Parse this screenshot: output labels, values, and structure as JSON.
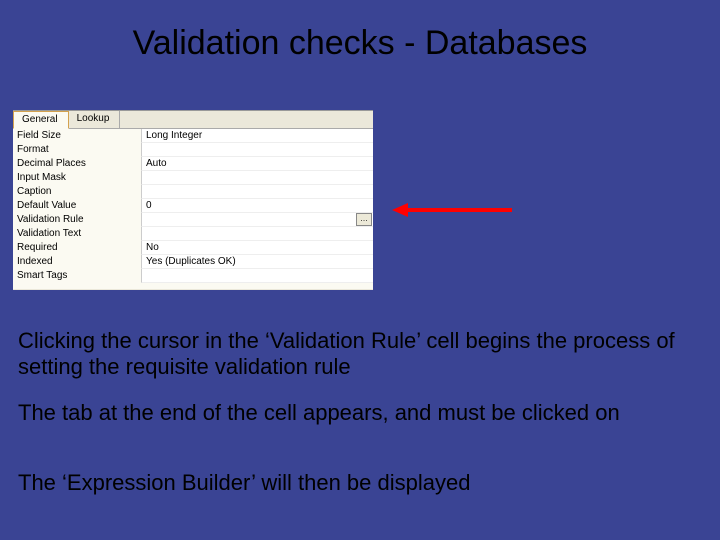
{
  "title": "Validation checks - Databases",
  "panel": {
    "tabs": {
      "general": "General",
      "lookup": "Lookup"
    },
    "rows": [
      {
        "label": "Field Size",
        "value": "Long Integer"
      },
      {
        "label": "Format",
        "value": ""
      },
      {
        "label": "Decimal Places",
        "value": "Auto"
      },
      {
        "label": "Input Mask",
        "value": ""
      },
      {
        "label": "Caption",
        "value": ""
      },
      {
        "label": "Default Value",
        "value": "0"
      },
      {
        "label": "Validation Rule",
        "value": "",
        "builder": true
      },
      {
        "label": "Validation Text",
        "value": ""
      },
      {
        "label": "Required",
        "value": "No"
      },
      {
        "label": "Indexed",
        "value": "Yes (Duplicates OK)"
      },
      {
        "label": "Smart Tags",
        "value": ""
      }
    ],
    "builder_label": "…"
  },
  "paragraphs": {
    "p1": "Clicking the cursor in the ‘Validation Rule’ cell begins the process of setting the requisite validation rule",
    "p2": "The tab at the end of the cell appears, and must be clicked on",
    "p3": "The ‘Expression Builder’ will then be displayed"
  }
}
